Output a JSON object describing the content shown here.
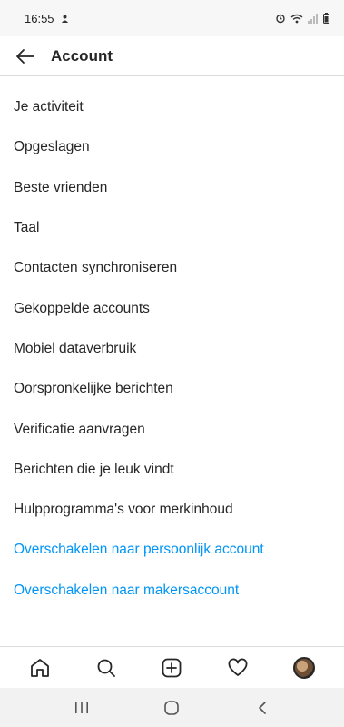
{
  "status_bar": {
    "time": "16:55",
    "icons": [
      "notification-icon",
      "alarm-icon",
      "wifi-icon",
      "signal-icon",
      "battery-icon"
    ]
  },
  "header": {
    "title": "Account",
    "back_icon": "arrow-left-icon"
  },
  "menu": {
    "items": [
      "Je activiteit",
      "Opgeslagen",
      "Beste vrienden",
      "Taal",
      "Contacten synchroniseren",
      "Gekoppelde accounts",
      "Mobiel dataverbruik",
      "Oorspronkelijke berichten",
      "Verificatie aanvragen",
      "Berichten die je leuk vindt",
      "Hulpprogramma's voor merkinhoud"
    ],
    "links": [
      "Overschakelen naar persoonlijk account",
      "Overschakelen naar makersaccount"
    ]
  },
  "bottom_nav": {
    "items": [
      "home-icon",
      "search-icon",
      "new-post-icon",
      "activity-heart-icon",
      "profile-avatar"
    ]
  },
  "system_nav": {
    "items": [
      "recent-apps-icon",
      "home-circle-icon",
      "back-chevron-icon"
    ]
  },
  "colors": {
    "text": "#262626",
    "link": "#0095f6",
    "divider": "#dbdbdb"
  }
}
